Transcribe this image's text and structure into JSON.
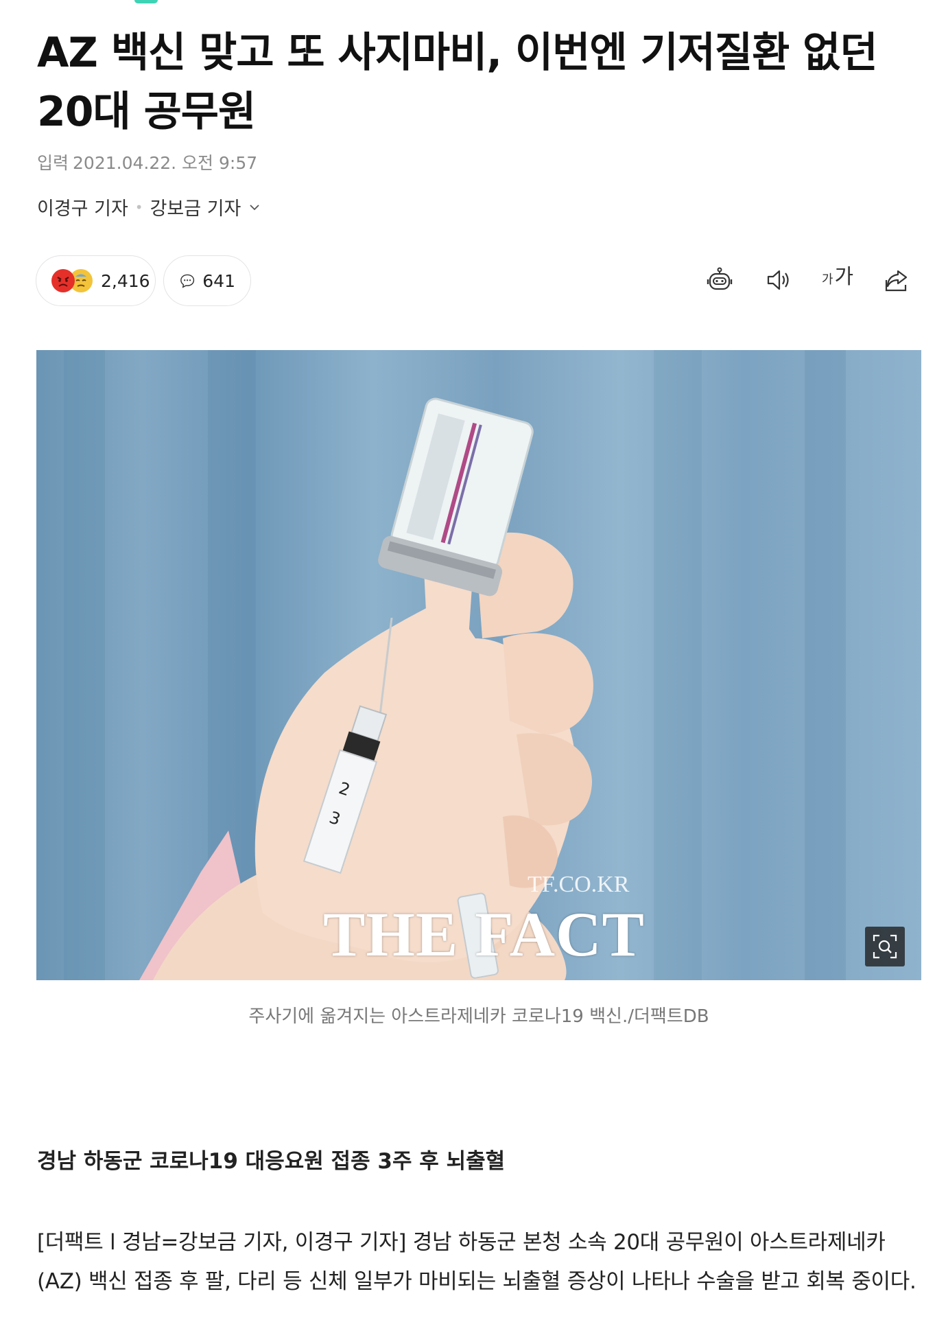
{
  "article": {
    "headline": "AZ 백신 맞고 또 사지마비, 이번엔 기저질환 없던 20대 공무원",
    "date_label": "입력",
    "date_value": "2021.04.22. 오전 9:57",
    "reporters": [
      "이경구 기자",
      "강보금 기자"
    ],
    "reactions_count": "2,416",
    "comments_count": "641",
    "font_size_small": "가",
    "font_size_big": "가",
    "photo": {
      "watermark_url": "TF.CO.KR",
      "watermark_brand": "THE FACT"
    },
    "caption": "주사기에 옮겨지는 아스트라제네카 코로나19 백신./더팩트DB",
    "subheading": "경남 하동군 코로나19 대응요원 접종 3주 후 뇌출혈",
    "body": "[더팩트 l 경남=강보금 기자, 이경구 기자] 경남 하동군 본청 소속 20대 공무원이 아스트라제네카(AZ) 백신 접종 후 팔, 다리 등 신체 일부가 마비되는 뇌출혈 증상이 나타나 수술을 받고 회복 중이다."
  },
  "icons": {
    "reaction_1": "angry-face-icon",
    "reaction_2": "sad-face-icon",
    "comment": "speech-bubble-icon",
    "summary": "robot-icon",
    "tts": "speaker-icon",
    "font": "font-size-icon",
    "share": "share-icon",
    "zoom": "zoom-icon",
    "chevron": "chevron-down-icon"
  },
  "colors": {
    "accent": "#3fd3b5",
    "angry": "#e5302a",
    "sad": "#f3c33a"
  }
}
